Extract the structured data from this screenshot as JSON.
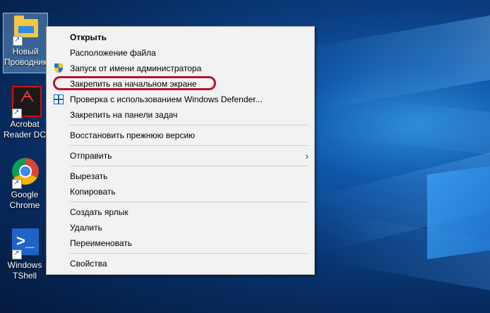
{
  "desktop": {
    "icons": [
      {
        "label": "Новый Проводник",
        "icon": "folder-icon"
      },
      {
        "label": "Acrobat Reader DC",
        "icon": "acrobat-icon"
      },
      {
        "label": "Google Chrome",
        "icon": "chrome-icon"
      },
      {
        "label": "Windows TShell",
        "icon": "powershell-icon"
      }
    ]
  },
  "context_menu": {
    "items": [
      {
        "label": "Открыть"
      },
      {
        "label": "Расположение файла"
      },
      {
        "label": "Запуск от имени администратора",
        "icon": "uac-shield-icon"
      },
      {
        "label": "Закрепить на начальном экране"
      },
      {
        "label": "Проверка с использованием Windows Defender...",
        "icon": "defender-icon"
      },
      {
        "label": "Закрепить на панели задач"
      },
      {
        "label": "Восстановить прежнюю версию"
      },
      {
        "label": "Отправить"
      },
      {
        "label": "Вырезать"
      },
      {
        "label": "Копировать"
      },
      {
        "label": "Создать ярлык"
      },
      {
        "label": "Удалить"
      },
      {
        "label": "Переименовать"
      },
      {
        "label": "Свойства"
      }
    ],
    "submenu_arrow": "›"
  },
  "colors": {
    "highlight_ring": "#b5142b",
    "menu_background": "#f2f2f2",
    "desktop_blue": "#0a3c7e"
  }
}
